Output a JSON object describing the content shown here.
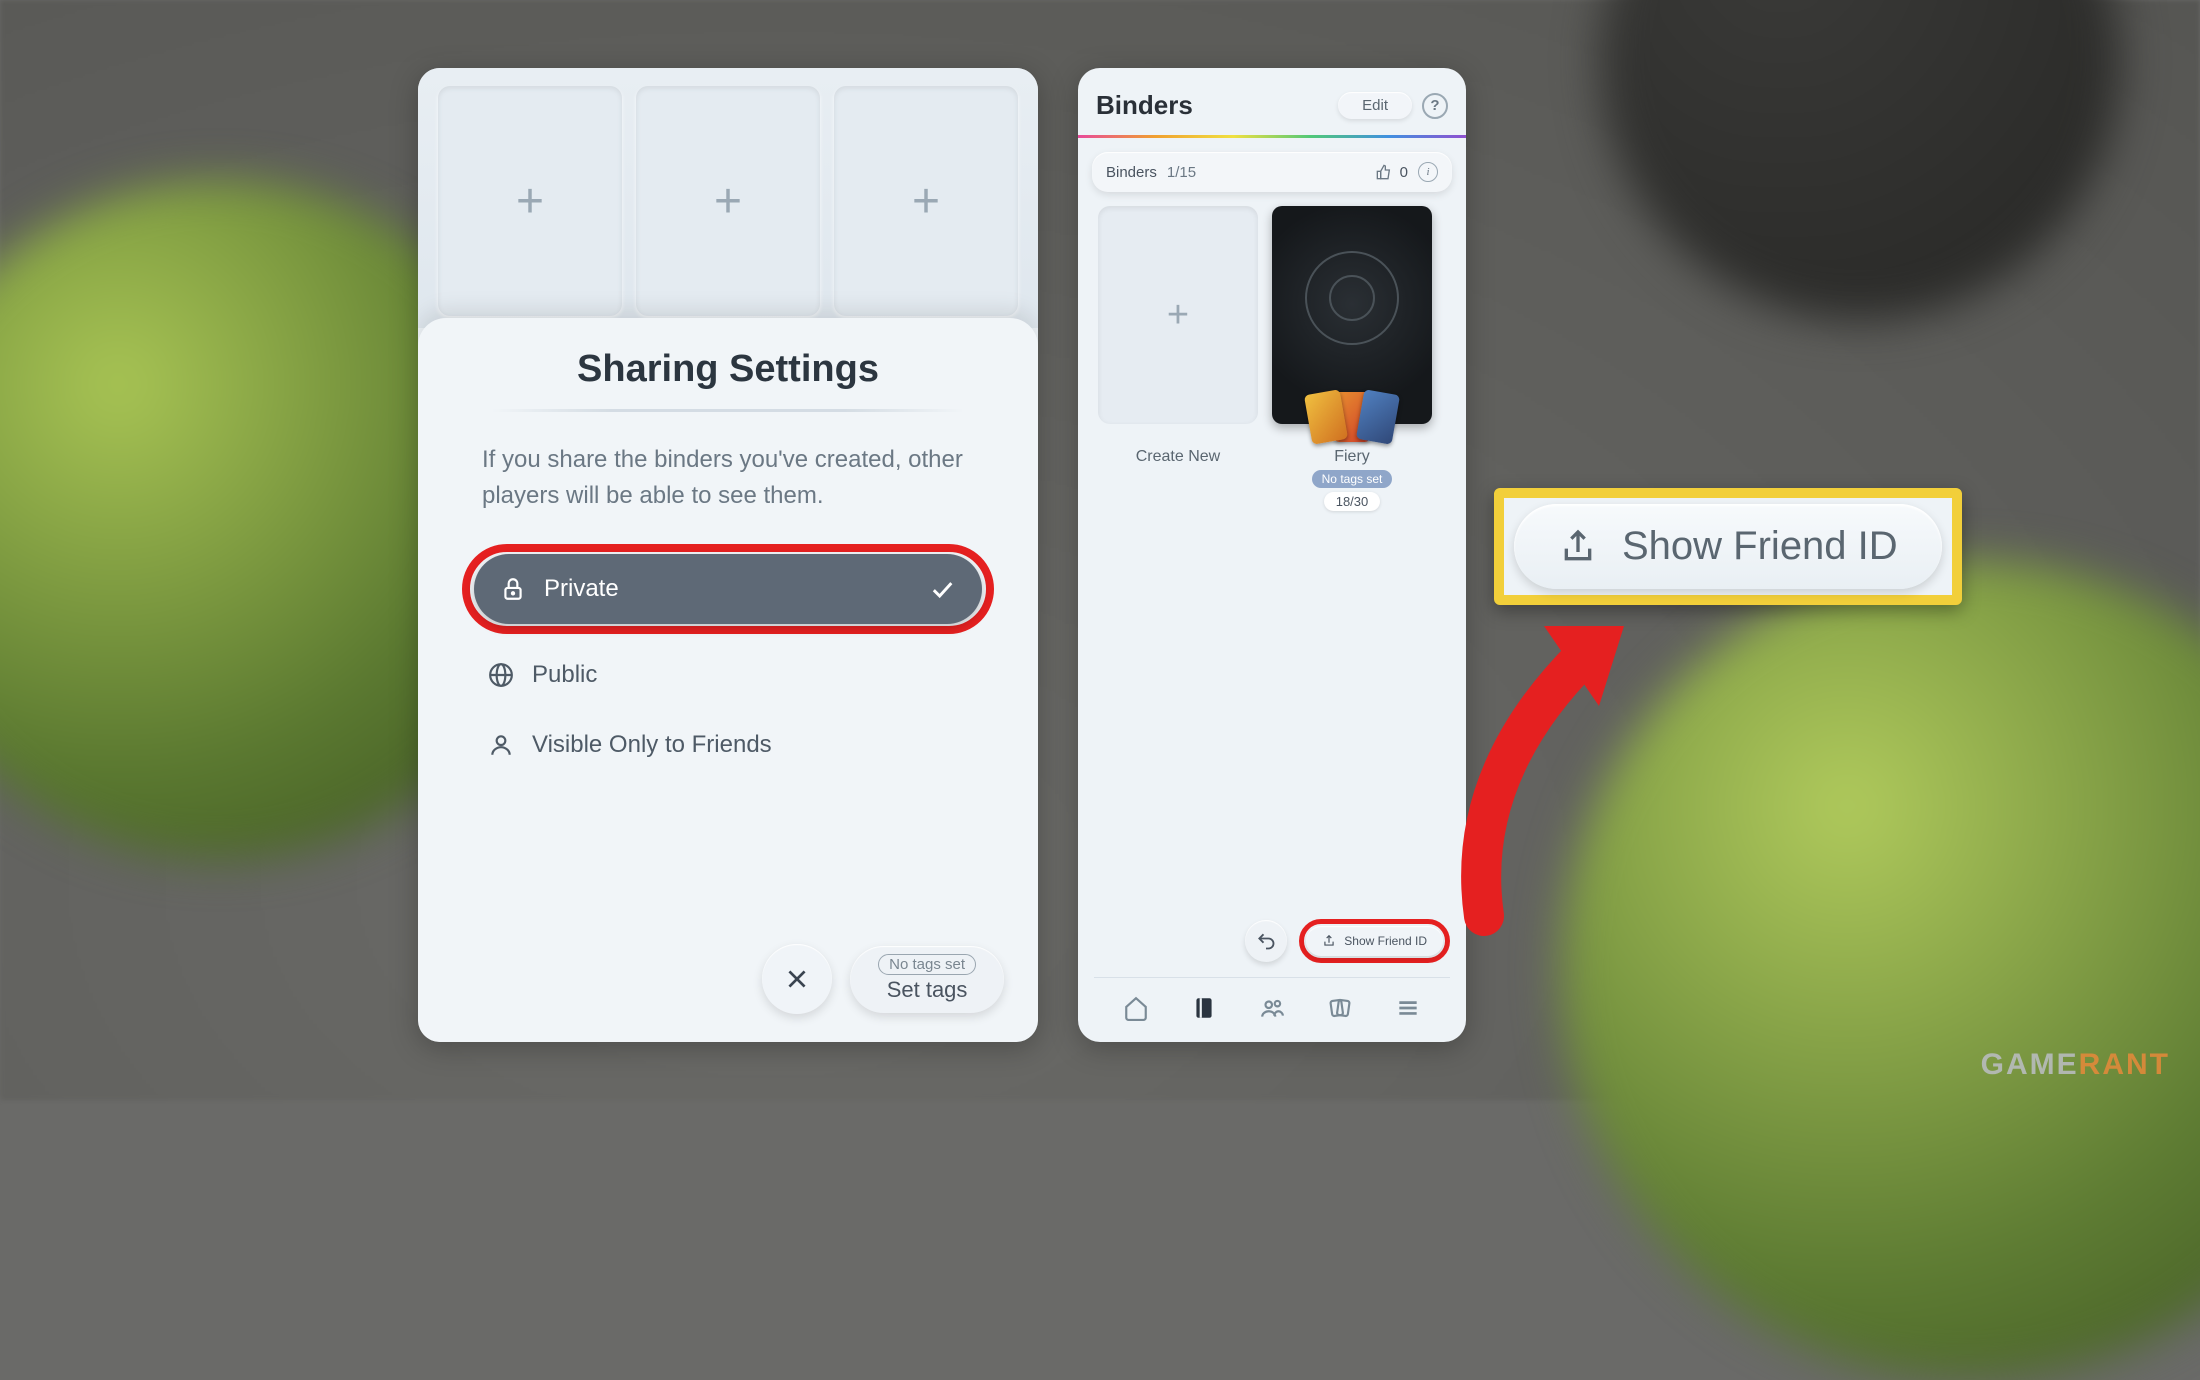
{
  "sharing": {
    "title": "Sharing Settings",
    "description": "If you share the binders you've created, other players will be able to see them.",
    "options": {
      "private": "Private",
      "public": "Public",
      "friends": "Visible Only to Friends"
    },
    "no_tags_pill": "No tags set",
    "set_tags": "Set tags"
  },
  "binders": {
    "title": "Binders",
    "edit": "Edit",
    "count_label": "Binders",
    "count": "1/15",
    "likes": "0",
    "create_new": "Create New",
    "binder_name": "Fiery",
    "binder_tag": "No tags set",
    "binder_count": "18/30",
    "show_friend_id": "Show Friend ID"
  },
  "callout": {
    "label": "Show Friend ID"
  },
  "watermark": {
    "a": "GAME",
    "b": "RANT"
  }
}
